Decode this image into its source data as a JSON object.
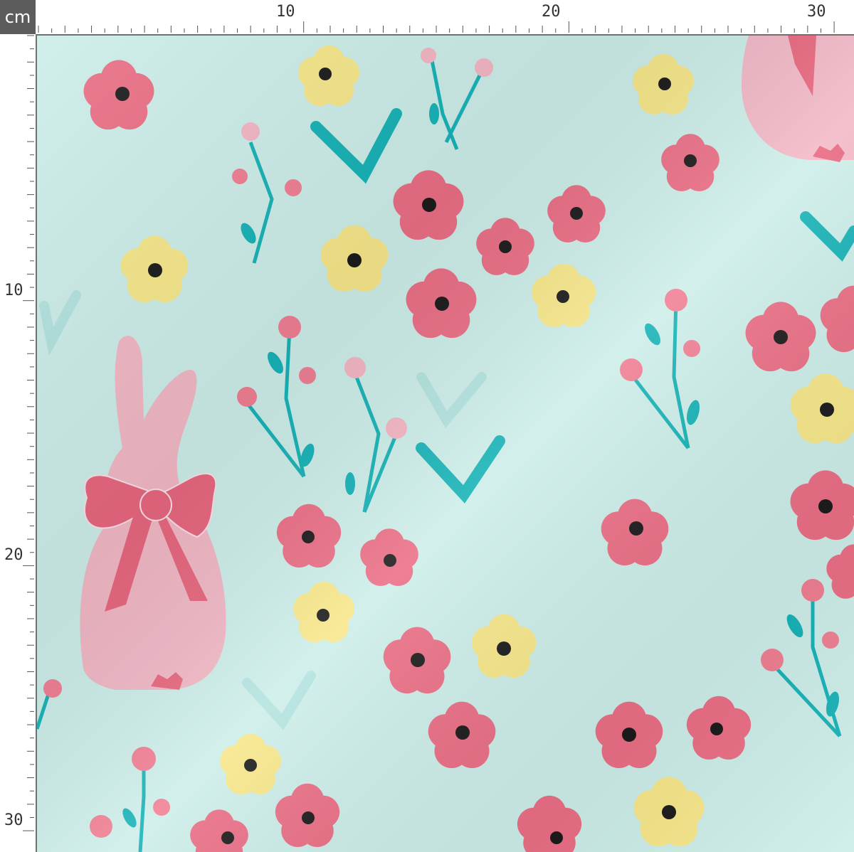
{
  "ruler": {
    "unit": "cm",
    "top_labels": [
      "10",
      "20",
      "30"
    ],
    "left_labels": [
      "10",
      "20",
      "30"
    ]
  },
  "fabric": {
    "background_color": "#cdeee9",
    "motifs": [
      "bunny",
      "bow",
      "pink-flower",
      "yellow-flower",
      "stem-flower",
      "heart-leaf"
    ],
    "colors": {
      "bunny": "#f2b8c6",
      "bow": "#e8677f",
      "pink_flower": "#eb6f86",
      "yellow_flower": "#f7e78a",
      "flower_center": "#1b1b1b",
      "stem": "#17b3b7",
      "bud": "#f07f93",
      "faint_leaf": "#b3e3df"
    }
  }
}
